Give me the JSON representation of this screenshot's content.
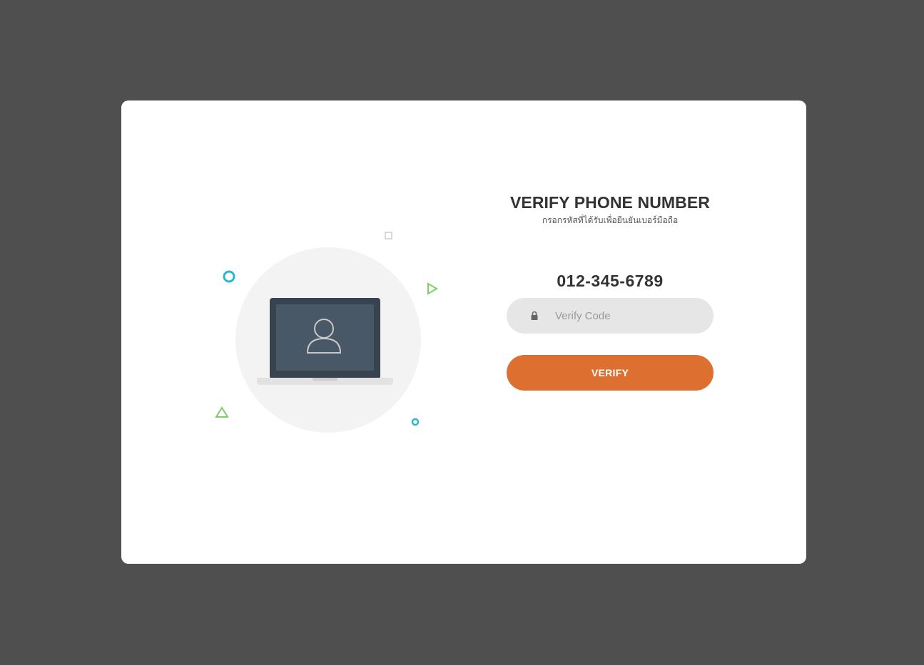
{
  "header": {
    "title": "VERIFY PHONE NUMBER",
    "subtitle": "กรอกรหัสที่ได้รับเพื่อยืนยันเบอร์มือถือ"
  },
  "phone_number": "012-345-6789",
  "verify_input": {
    "placeholder": "Verify Code",
    "value": "",
    "icon": "lock-icon"
  },
  "verify_button": {
    "label": "VERIFY"
  },
  "illustration": {
    "icons": [
      "laptop-icon",
      "user-icon"
    ],
    "accent_colors": {
      "teal": "#29b6d6",
      "green": "#7dcf6b",
      "grey": "#d8d8d8"
    }
  },
  "colors": {
    "background": "#4f4f4f",
    "card": "#ffffff",
    "button": "#dd6f30",
    "input_bg": "#e6e6e6",
    "text_dark": "#333333"
  }
}
